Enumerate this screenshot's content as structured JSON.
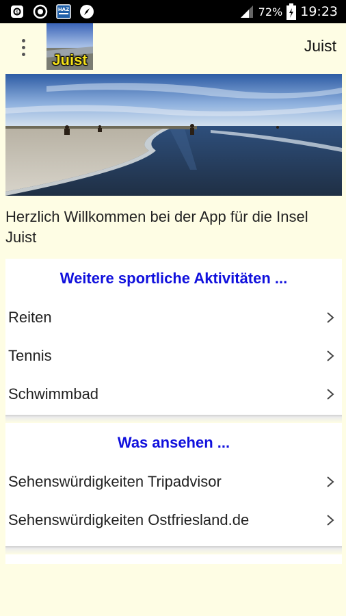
{
  "status_bar": {
    "battery_percent": "72%",
    "time": "19:23",
    "icons": [
      "whatsapp-icon",
      "sync-icon",
      "haz-app-icon",
      "compass-icon",
      "signal-icon",
      "battery-icon"
    ],
    "haz_label": "HAZ"
  },
  "app_bar": {
    "menu_icon": "overflow-menu-icon",
    "logo_text": "Juist",
    "title": "Juist"
  },
  "welcome_text": "Herzlich Willkommen bei der App für die Insel Juist",
  "sections": [
    {
      "heading": "Weitere sportliche Aktivitäten ...",
      "items": [
        {
          "label": "Reiten"
        },
        {
          "label": "Tennis"
        },
        {
          "label": "Schwimmbad"
        }
      ]
    },
    {
      "heading": "Was ansehen ...",
      "items": [
        {
          "label": "Sehenswürdigkeiten Tripadvisor"
        },
        {
          "label": "Sehenswürdigkeiten Ostfriesland.de"
        }
      ]
    }
  ],
  "colors": {
    "background": "#fefde4",
    "heading": "#1010dd",
    "status_bar": "#000000"
  }
}
